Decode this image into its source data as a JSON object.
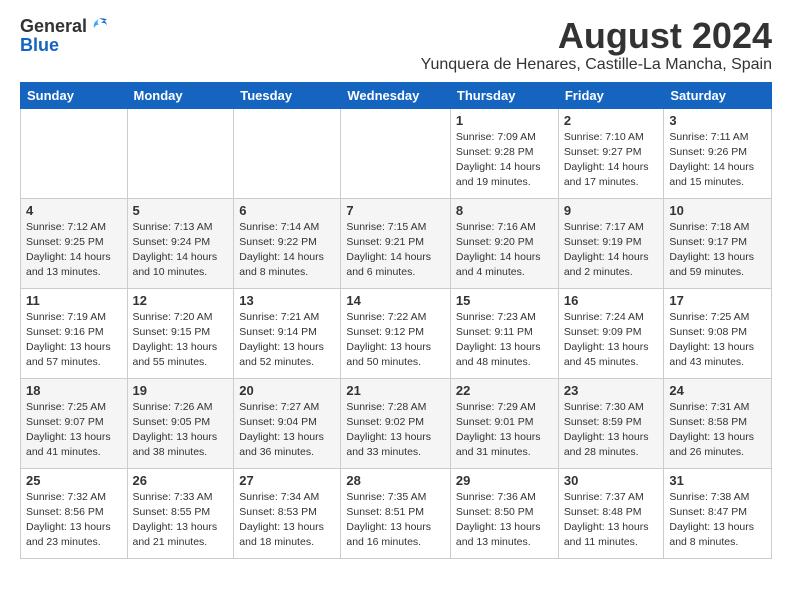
{
  "logo": {
    "general": "General",
    "blue": "Blue"
  },
  "title": "August 2024",
  "location": "Yunquera de Henares, Castille-La Mancha, Spain",
  "days_header": [
    "Sunday",
    "Monday",
    "Tuesday",
    "Wednesday",
    "Thursday",
    "Friday",
    "Saturday"
  ],
  "weeks": [
    [
      {
        "day": "",
        "info": ""
      },
      {
        "day": "",
        "info": ""
      },
      {
        "day": "",
        "info": ""
      },
      {
        "day": "",
        "info": ""
      },
      {
        "day": "1",
        "info": "Sunrise: 7:09 AM\nSunset: 9:28 PM\nDaylight: 14 hours\nand 19 minutes."
      },
      {
        "day": "2",
        "info": "Sunrise: 7:10 AM\nSunset: 9:27 PM\nDaylight: 14 hours\nand 17 minutes."
      },
      {
        "day": "3",
        "info": "Sunrise: 7:11 AM\nSunset: 9:26 PM\nDaylight: 14 hours\nand 15 minutes."
      }
    ],
    [
      {
        "day": "4",
        "info": "Sunrise: 7:12 AM\nSunset: 9:25 PM\nDaylight: 14 hours\nand 13 minutes."
      },
      {
        "day": "5",
        "info": "Sunrise: 7:13 AM\nSunset: 9:24 PM\nDaylight: 14 hours\nand 10 minutes."
      },
      {
        "day": "6",
        "info": "Sunrise: 7:14 AM\nSunset: 9:22 PM\nDaylight: 14 hours\nand 8 minutes."
      },
      {
        "day": "7",
        "info": "Sunrise: 7:15 AM\nSunset: 9:21 PM\nDaylight: 14 hours\nand 6 minutes."
      },
      {
        "day": "8",
        "info": "Sunrise: 7:16 AM\nSunset: 9:20 PM\nDaylight: 14 hours\nand 4 minutes."
      },
      {
        "day": "9",
        "info": "Sunrise: 7:17 AM\nSunset: 9:19 PM\nDaylight: 14 hours\nand 2 minutes."
      },
      {
        "day": "10",
        "info": "Sunrise: 7:18 AM\nSunset: 9:17 PM\nDaylight: 13 hours\nand 59 minutes."
      }
    ],
    [
      {
        "day": "11",
        "info": "Sunrise: 7:19 AM\nSunset: 9:16 PM\nDaylight: 13 hours\nand 57 minutes."
      },
      {
        "day": "12",
        "info": "Sunrise: 7:20 AM\nSunset: 9:15 PM\nDaylight: 13 hours\nand 55 minutes."
      },
      {
        "day": "13",
        "info": "Sunrise: 7:21 AM\nSunset: 9:14 PM\nDaylight: 13 hours\nand 52 minutes."
      },
      {
        "day": "14",
        "info": "Sunrise: 7:22 AM\nSunset: 9:12 PM\nDaylight: 13 hours\nand 50 minutes."
      },
      {
        "day": "15",
        "info": "Sunrise: 7:23 AM\nSunset: 9:11 PM\nDaylight: 13 hours\nand 48 minutes."
      },
      {
        "day": "16",
        "info": "Sunrise: 7:24 AM\nSunset: 9:09 PM\nDaylight: 13 hours\nand 45 minutes."
      },
      {
        "day": "17",
        "info": "Sunrise: 7:25 AM\nSunset: 9:08 PM\nDaylight: 13 hours\nand 43 minutes."
      }
    ],
    [
      {
        "day": "18",
        "info": "Sunrise: 7:25 AM\nSunset: 9:07 PM\nDaylight: 13 hours\nand 41 minutes."
      },
      {
        "day": "19",
        "info": "Sunrise: 7:26 AM\nSunset: 9:05 PM\nDaylight: 13 hours\nand 38 minutes."
      },
      {
        "day": "20",
        "info": "Sunrise: 7:27 AM\nSunset: 9:04 PM\nDaylight: 13 hours\nand 36 minutes."
      },
      {
        "day": "21",
        "info": "Sunrise: 7:28 AM\nSunset: 9:02 PM\nDaylight: 13 hours\nand 33 minutes."
      },
      {
        "day": "22",
        "info": "Sunrise: 7:29 AM\nSunset: 9:01 PM\nDaylight: 13 hours\nand 31 minutes."
      },
      {
        "day": "23",
        "info": "Sunrise: 7:30 AM\nSunset: 8:59 PM\nDaylight: 13 hours\nand 28 minutes."
      },
      {
        "day": "24",
        "info": "Sunrise: 7:31 AM\nSunset: 8:58 PM\nDaylight: 13 hours\nand 26 minutes."
      }
    ],
    [
      {
        "day": "25",
        "info": "Sunrise: 7:32 AM\nSunset: 8:56 PM\nDaylight: 13 hours\nand 23 minutes."
      },
      {
        "day": "26",
        "info": "Sunrise: 7:33 AM\nSunset: 8:55 PM\nDaylight: 13 hours\nand 21 minutes."
      },
      {
        "day": "27",
        "info": "Sunrise: 7:34 AM\nSunset: 8:53 PM\nDaylight: 13 hours\nand 18 minutes."
      },
      {
        "day": "28",
        "info": "Sunrise: 7:35 AM\nSunset: 8:51 PM\nDaylight: 13 hours\nand 16 minutes."
      },
      {
        "day": "29",
        "info": "Sunrise: 7:36 AM\nSunset: 8:50 PM\nDaylight: 13 hours\nand 13 minutes."
      },
      {
        "day": "30",
        "info": "Sunrise: 7:37 AM\nSunset: 8:48 PM\nDaylight: 13 hours\nand 11 minutes."
      },
      {
        "day": "31",
        "info": "Sunrise: 7:38 AM\nSunset: 8:47 PM\nDaylight: 13 hours\nand 8 minutes."
      }
    ]
  ]
}
